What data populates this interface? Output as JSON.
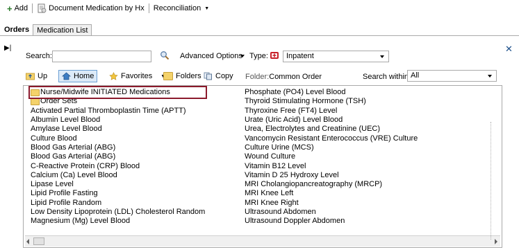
{
  "toolbar": {
    "add_label": "Add",
    "doc_med_label": "Document Medication by Hx",
    "reconciliation_label": "Reconciliation"
  },
  "tabs": [
    {
      "label": "Orders"
    },
    {
      "label": "Medication List"
    }
  ],
  "search": {
    "label": "Search:",
    "value": "",
    "advanced_label": "Advanced Options",
    "type_label": "Type:",
    "type_value": "Inpatent"
  },
  "nav": {
    "up_label": "Up",
    "home_label": "Home",
    "favorites_label": "Favorites",
    "folders_label": "Folders",
    "copy_label": "Copy",
    "folder_label": "Folder:",
    "folder_value": "Common Order",
    "search_within_label": "Search within:",
    "search_within_value": "All"
  },
  "list_left": [
    {
      "label": "Nurse/Midwife INITIATED Medications",
      "folder": true
    },
    {
      "label": "Order Sets",
      "folder": true
    },
    {
      "label": "Activated Partial Thromboplastin Time (APTT)"
    },
    {
      "label": "Albumin Level Blood"
    },
    {
      "label": "Amylase Level Blood"
    },
    {
      "label": "Culture Blood"
    },
    {
      "label": "Blood Gas Arterial (ABG)"
    },
    {
      "label": "Blood Gas Arterial (ABG)"
    },
    {
      "label": "C-Reactive Protein (CRP) Blood"
    },
    {
      "label": "Calcium (Ca) Level Blood"
    },
    {
      "label": "Lipase Level"
    },
    {
      "label": "Lipid Profile Fasting"
    },
    {
      "label": "Lipid Profile Random"
    },
    {
      "label": "Low Density Lipoprotein (LDL) Cholesterol Random"
    },
    {
      "label": "Magnesium (Mg) Level Blood"
    }
  ],
  "list_right": [
    {
      "label": "Phosphate (PO4) Level Blood"
    },
    {
      "label": "Thyroid Stimulating Hormone (TSH)"
    },
    {
      "label": "Thyroxine Free (FT4) Level"
    },
    {
      "label": "Urate (Uric Acid) Level Blood"
    },
    {
      "label": "Urea, Electrolytes and Creatinine (UEC)"
    },
    {
      "label": "Vancomycin Resistant Enterococcus (VRE) Culture"
    },
    {
      "label": "Culture Urine (MCS)"
    },
    {
      "label": "Wound Culture"
    },
    {
      "label": "Vitamin B12 Level"
    },
    {
      "label": "Vitamin D 25 Hydroxy Level"
    },
    {
      "label": "MRI Cholangiopancreatography (MRCP)"
    },
    {
      "label": "MRI Knee Left"
    },
    {
      "label": "MRI Knee Right"
    },
    {
      "label": "Ultrasound Abdomen"
    },
    {
      "label": "Ultrasound Doppler Abdomen"
    }
  ],
  "colors": {
    "highlight": "#8b1a2b",
    "accent": "#1a4e8a",
    "folder": "#f4d26a"
  }
}
